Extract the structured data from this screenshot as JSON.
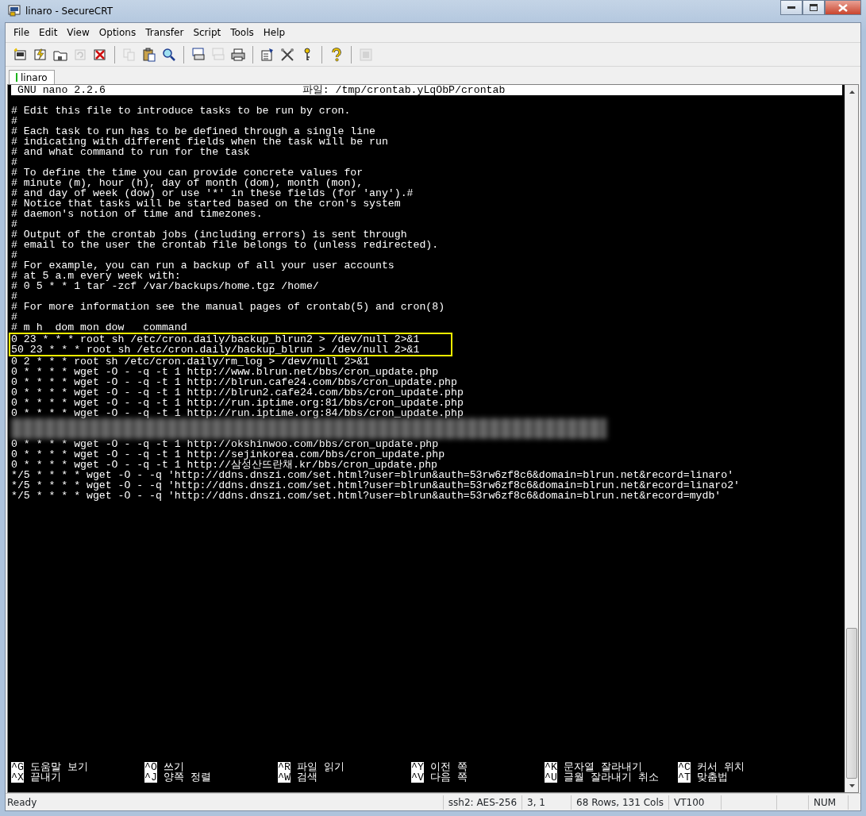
{
  "window": {
    "title": "linaro - SecureCRT"
  },
  "menu": [
    "File",
    "Edit",
    "View",
    "Options",
    "Transfer",
    "Script",
    "Tools",
    "Help"
  ],
  "toolbar": [
    {
      "kind": "button",
      "disabled": false
    },
    {
      "kind": "button",
      "disabled": false
    },
    {
      "kind": "button",
      "disabled": false
    },
    {
      "kind": "button",
      "disabled": true
    },
    {
      "kind": "button",
      "disabled": false
    },
    {
      "kind": "separator"
    },
    {
      "kind": "button",
      "disabled": true
    },
    {
      "kind": "button",
      "disabled": false
    },
    {
      "kind": "button",
      "disabled": false
    },
    {
      "kind": "separator"
    },
    {
      "kind": "button",
      "disabled": false
    },
    {
      "kind": "button",
      "disabled": true
    },
    {
      "kind": "button",
      "disabled": false
    },
    {
      "kind": "separator"
    },
    {
      "kind": "button",
      "disabled": false
    },
    {
      "kind": "button",
      "disabled": false
    },
    {
      "kind": "button",
      "disabled": false
    },
    {
      "kind": "separator"
    },
    {
      "kind": "button",
      "disabled": false
    },
    {
      "kind": "separator"
    },
    {
      "kind": "button",
      "disabled": true
    }
  ],
  "tabs": [
    {
      "label": "linaro",
      "selected": true
    }
  ],
  "nano_header": {
    "version": "GNU nano 2.2.6",
    "file": "파일: /tmp/crontab.yLqObP/crontab"
  },
  "lines": [
    {
      "kind": "text",
      "text": "# Edit this file to introduce tasks to be run by cron.",
      "highlighted": false
    },
    {
      "kind": "text",
      "text": "#",
      "highlighted": false
    },
    {
      "kind": "text",
      "text": "# Each task to run has to be defined through a single line",
      "highlighted": false
    },
    {
      "kind": "text",
      "text": "# indicating with different fields when the task will be run",
      "highlighted": false
    },
    {
      "kind": "text",
      "text": "# and what command to run for the task",
      "highlighted": false
    },
    {
      "kind": "text",
      "text": "#",
      "highlighted": false
    },
    {
      "kind": "text",
      "text": "# To define the time you can provide concrete values for",
      "highlighted": false
    },
    {
      "kind": "text",
      "text": "# minute (m), hour (h), day of month (dom), month (mon),",
      "highlighted": false
    },
    {
      "kind": "text",
      "text": "# and day of week (dow) or use '*' in these fields (for 'any').#",
      "highlighted": false
    },
    {
      "kind": "text",
      "text": "# Notice that tasks will be started based on the cron's system",
      "highlighted": false
    },
    {
      "kind": "text",
      "text": "# daemon's notion of time and timezones.",
      "highlighted": false
    },
    {
      "kind": "text",
      "text": "#",
      "highlighted": false
    },
    {
      "kind": "text",
      "text": "# Output of the crontab jobs (including errors) is sent through",
      "highlighted": false
    },
    {
      "kind": "text",
      "text": "# email to the user the crontab file belongs to (unless redirected).",
      "highlighted": false
    },
    {
      "kind": "text",
      "text": "#",
      "highlighted": false
    },
    {
      "kind": "text",
      "text": "# For example, you can run a backup of all your user accounts",
      "highlighted": false
    },
    {
      "kind": "text",
      "text": "# at 5 a.m every week with:",
      "highlighted": false
    },
    {
      "kind": "text",
      "text": "# 0 5 * * 1 tar -zcf /var/backups/home.tgz /home/",
      "highlighted": false
    },
    {
      "kind": "text",
      "text": "#",
      "highlighted": false
    },
    {
      "kind": "text",
      "text": "# For more information see the manual pages of crontab(5) and cron(8)",
      "highlighted": false
    },
    {
      "kind": "text",
      "text": "#",
      "highlighted": false
    },
    {
      "kind": "text",
      "text": "# m h  dom mon dow   command",
      "highlighted": false
    },
    {
      "kind": "text",
      "text": "0 23 * * * root sh /etc/cron.daily/backup_blrun2 > /dev/null 2>&1",
      "highlighted": true
    },
    {
      "kind": "text",
      "text": "50 23 * * * root sh /etc/cron.daily/backup_blrun > /dev/null 2>&1",
      "highlighted": true
    },
    {
      "kind": "text",
      "text": "0 2 * * * root sh /etc/cron.daily/rm_log > /dev/null 2>&1",
      "highlighted": false
    },
    {
      "kind": "text",
      "text": "0 * * * * wget -O - -q -t 1 http://www.blrun.net/bbs/cron_update.php",
      "highlighted": false
    },
    {
      "kind": "text",
      "text": "0 * * * * wget -O - -q -t 1 http://blrun.cafe24.com/bbs/cron_update.php",
      "highlighted": false
    },
    {
      "kind": "text",
      "text": "0 * * * * wget -O - -q -t 1 http://blrun2.cafe24.com/bbs/cron_update.php",
      "highlighted": false
    },
    {
      "kind": "text",
      "text": "0 * * * * wget -O - -q -t 1 http://run.iptime.org:81/bbs/cron_update.php",
      "highlighted": false
    },
    {
      "kind": "text",
      "text": "0 * * * * wget -O - -q -t 1 http://run.iptime.org:84/bbs/cron_update.php",
      "highlighted": false
    },
    {
      "kind": "redacted",
      "highlighted": false
    },
    {
      "kind": "text",
      "text": "0 * * * * wget -O - -q -t 1 http://okshinwoo.com/bbs/cron_update.php",
      "highlighted": false
    },
    {
      "kind": "text",
      "text": "0 * * * * wget -O - -q -t 1 http://sejinkorea.com/bbs/cron_update.php",
      "highlighted": false
    },
    {
      "kind": "text",
      "text": "0 * * * * wget -O - -q -t 1 http://삼성산뜨란채.kr/bbs/cron_update.php",
      "highlighted": false
    },
    {
      "kind": "text",
      "text": "*/5 * * * * wget -O - -q 'http://ddns.dnszi.com/set.html?user=blrun&auth=53rw6zf8c6&domain=blrun.net&record=linaro'",
      "highlighted": false
    },
    {
      "kind": "text",
      "text": "*/5 * * * * wget -O - -q 'http://ddns.dnszi.com/set.html?user=blrun&auth=53rw6zf8c6&domain=blrun.net&record=linaro2'",
      "highlighted": false
    },
    {
      "kind": "text",
      "text": "*/5 * * * * wget -O - -q 'http://ddns.dnszi.com/set.html?user=blrun&auth=53rw6zf8c6&domain=blrun.net&record=mydb'",
      "highlighted": false
    }
  ],
  "shortcuts": [
    {
      "key": "^G",
      "label": "도움말 보기"
    },
    {
      "key": "^X",
      "label": "끝내기"
    },
    {
      "key": "^O",
      "label": "쓰기"
    },
    {
      "key": "^J",
      "label": "양쪽 정렬"
    },
    {
      "key": "^R",
      "label": "파일 읽기"
    },
    {
      "key": "^W",
      "label": "검색"
    },
    {
      "key": "^Y",
      "label": "이전 쪽"
    },
    {
      "key": "^V",
      "label": "다음 쪽"
    },
    {
      "key": "^K",
      "label": "문자열 잘라내기"
    },
    {
      "key": "^U",
      "label": "글월 잘라내기 취소"
    },
    {
      "key": "^C",
      "label": "커서 위치"
    },
    {
      "key": "^T",
      "label": "맞춤법"
    }
  ],
  "status_bar": {
    "message": "Ready",
    "cipher": "ssh2: AES-256",
    "cursor": "3,   1",
    "size": "68 Rows, 131 Cols",
    "emulation": "VT100",
    "num_lock": "NUM"
  }
}
